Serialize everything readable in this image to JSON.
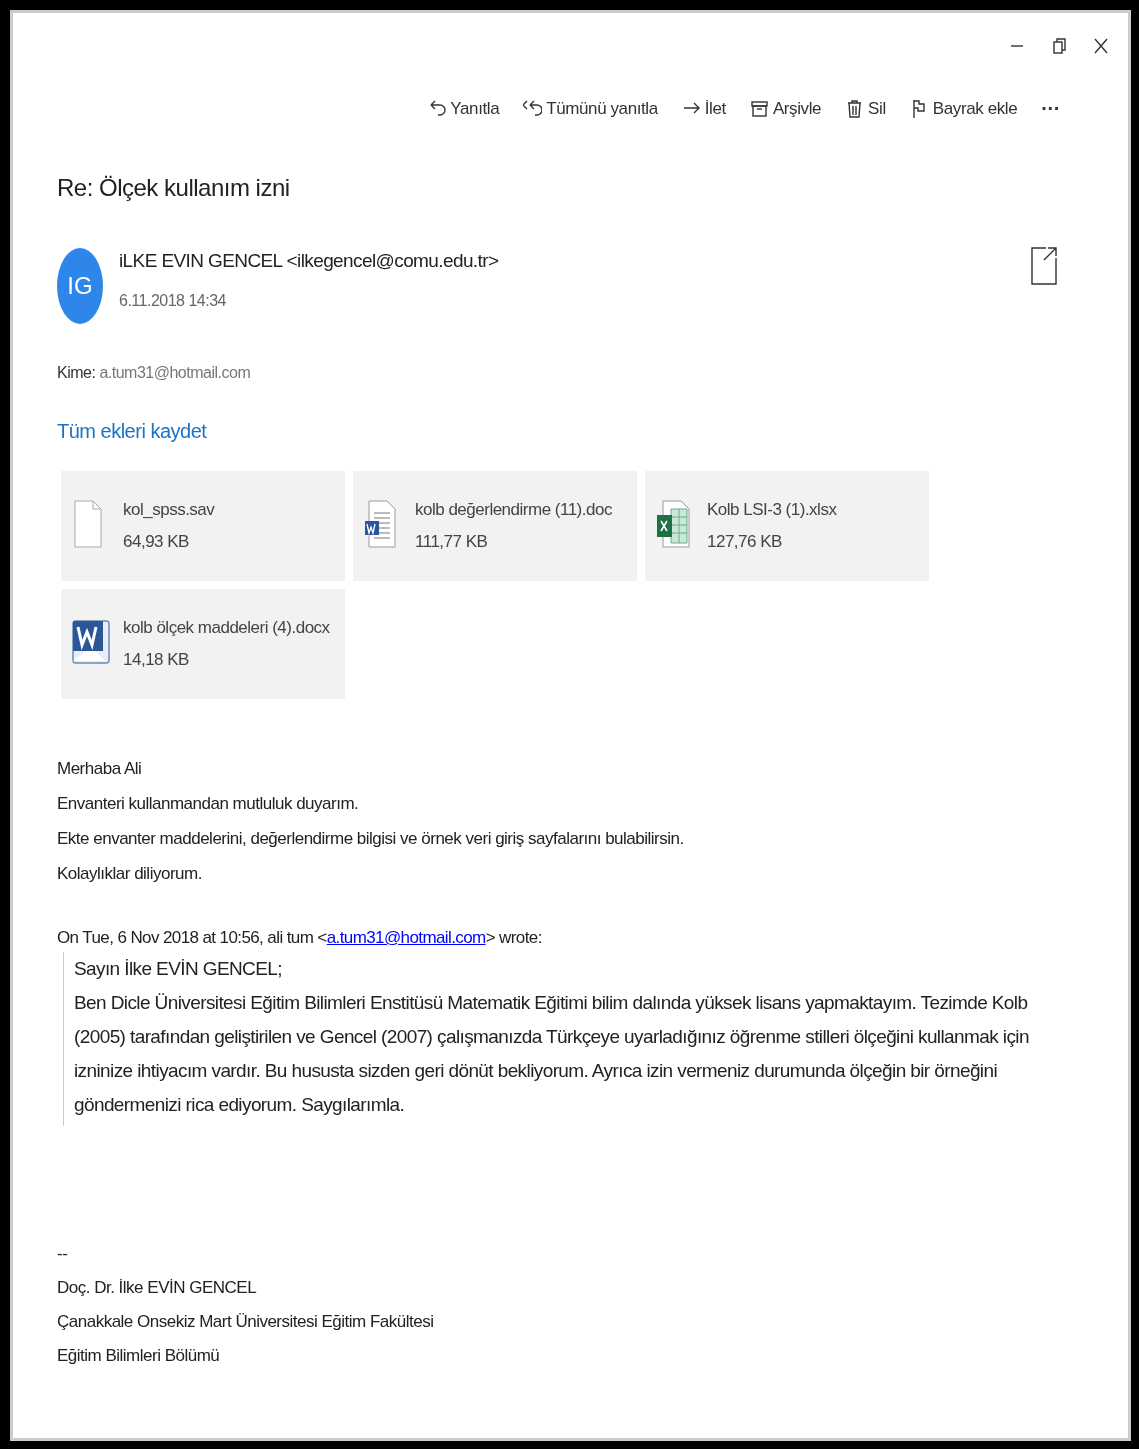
{
  "window": {
    "controls": [
      {
        "kind": "minimize"
      },
      {
        "kind": "restore"
      },
      {
        "kind": "close"
      }
    ]
  },
  "toolbar": [
    {
      "kind": "reply",
      "label": "Yanıtla"
    },
    {
      "kind": "reply-all",
      "label": "Tümünü yanıtla"
    },
    {
      "kind": "forward",
      "label": "İlet"
    },
    {
      "kind": "archive",
      "label": "Arşivle"
    },
    {
      "kind": "delete",
      "label": "Sil"
    },
    {
      "kind": "flag",
      "label": "Bayrak ekle"
    },
    {
      "kind": "more",
      "label": "···"
    }
  ],
  "message": {
    "subject": "Re: Ölçek kullanım izni",
    "avatar": "IG",
    "sender": "iLKE EVIN GENCEL <ilkegencel@comu.edu.tr>",
    "date": "6.11.2018 14:34",
    "to_label": "Kime:",
    "to": "a.tum31@hotmail.com",
    "save_all": "Tüm ekleri kaydet",
    "attachments": [
      {
        "kind": "file",
        "name": "kol_spss.sav",
        "size": "64,93 KB"
      },
      {
        "kind": "doc",
        "name": "kolb değerlendirme (11).doc",
        "size": "111,77 KB"
      },
      {
        "kind": "xlsx",
        "name": "Kolb LSI-3 (1).xlsx",
        "size": "127,76 KB"
      },
      {
        "kind": "docx",
        "name": "kolb ölçek maddeleri (4).docx",
        "size": "14,18 KB"
      }
    ],
    "body": [
      "Merhaba Ali",
      "Envanteri kullanmandan mutluluk duyarım.",
      "Ekte envanter maddelerini, değerlendirme bilgisi ve örnek veri giriş sayfalarını bulabilirsin.",
      "Kolaylıklar diliyorum."
    ],
    "quote_header": {
      "before": "On Tue, 6 Nov 2018 at 10:56, ali tum <",
      "link": "a.tum31@hotmail.com",
      "after": "> wrote:"
    },
    "quote": [
      "Sayın İlke EVİN GENCEL;",
      "Ben Dicle Üniversitesi Eğitim Bilimleri Enstitüsü Matematik Eğitimi bilim dalında yüksek lisans yapmaktayım. Tezimde  Kolb (2005) tarafından geliştirilen ve Gencel (2007) çalışmanızda Türkçeye uyarladığınız öğrenme stilleri ölçeğini kullanmak için izninize ihtiyacım vardır. Bu hususta sizden geri dönüt bekliyorum. Ayrıca izin vermeniz durumunda ölçeğin bir örneğini göndermenizi rica ediyorum. Saygılarımla."
    ],
    "signature": [
      "--",
      "Doç. Dr. İlke EVİN GENCEL",
      "Çanakkale Onsekiz Mart Üniversitesi Eğitim Fakültesi",
      "Eğitim Bilimleri Bölümü"
    ]
  }
}
